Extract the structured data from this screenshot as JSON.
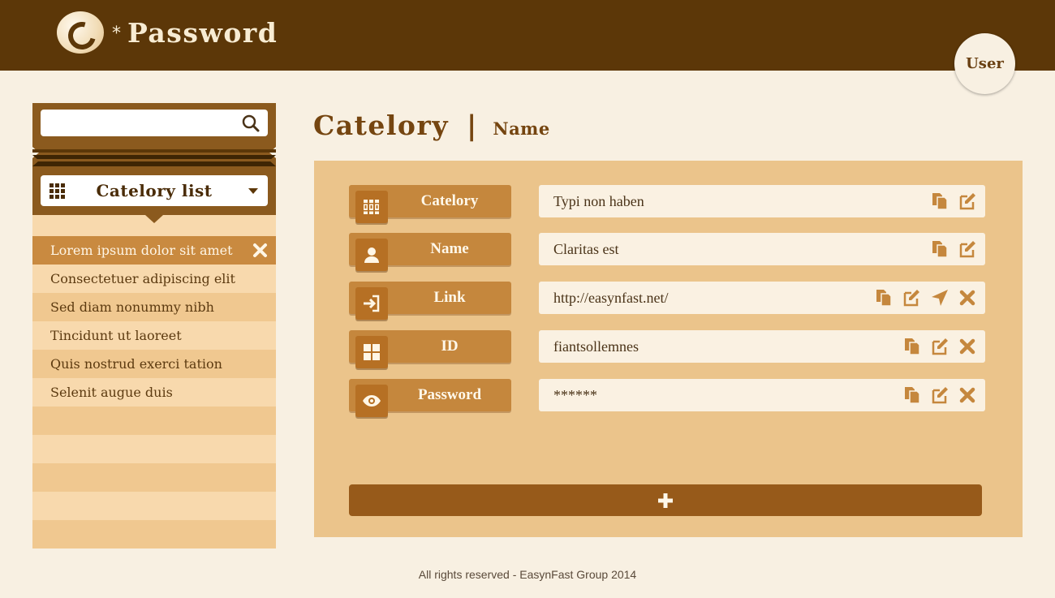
{
  "header": {
    "logo_letter": "e",
    "logo_star": "*",
    "app_title": "Password",
    "user_label": "User"
  },
  "sidebar": {
    "search": {
      "value": "",
      "placeholder": ""
    },
    "category_dropdown": {
      "label": "Catelory list"
    },
    "items": [
      {
        "label": "Lorem ipsum dolor sit amet",
        "active": true
      },
      {
        "label": "Consectetuer adipiscing elit",
        "active": false
      },
      {
        "label": "Sed diam nonummy nibh",
        "active": false
      },
      {
        "label": "Tincidunt ut laoreet",
        "active": false
      },
      {
        "label": "Quis nostrud exerci tation",
        "active": false
      },
      {
        "label": "Selenit augue duis",
        "active": false
      }
    ]
  },
  "main": {
    "heading": {
      "category": "Catelory",
      "separator": "|",
      "name": "Name"
    },
    "fields": [
      {
        "label": "Catelory",
        "icon": "books-icon",
        "value": "Typi non haben",
        "actions": [
          "copy",
          "edit"
        ]
      },
      {
        "label": "Name",
        "icon": "user-icon",
        "value": "Claritas est",
        "actions": [
          "copy",
          "edit"
        ]
      },
      {
        "label": "Link",
        "icon": "sign-in-icon",
        "value": "http://easynfast.net/",
        "actions": [
          "copy",
          "edit",
          "navigate",
          "delete"
        ]
      },
      {
        "label": "ID",
        "icon": "grid-icon",
        "value": "fiantsollemnes",
        "actions": [
          "copy",
          "edit",
          "delete"
        ]
      },
      {
        "label": "Password",
        "icon": "eye-icon",
        "value": "******",
        "actions": [
          "copy",
          "edit",
          "delete"
        ]
      }
    ],
    "add_button_icon": "plus-icon"
  },
  "footer": {
    "text": "All rights reserved - EasynFast Group 2014"
  },
  "colors": {
    "header_bg": "#5c3708",
    "page_bg": "#f8f0e2",
    "panel_bg": "#ebc48b",
    "label_bg": "#c5873d",
    "accent_dark": "#975a1a",
    "list_active": "#c98a40"
  }
}
